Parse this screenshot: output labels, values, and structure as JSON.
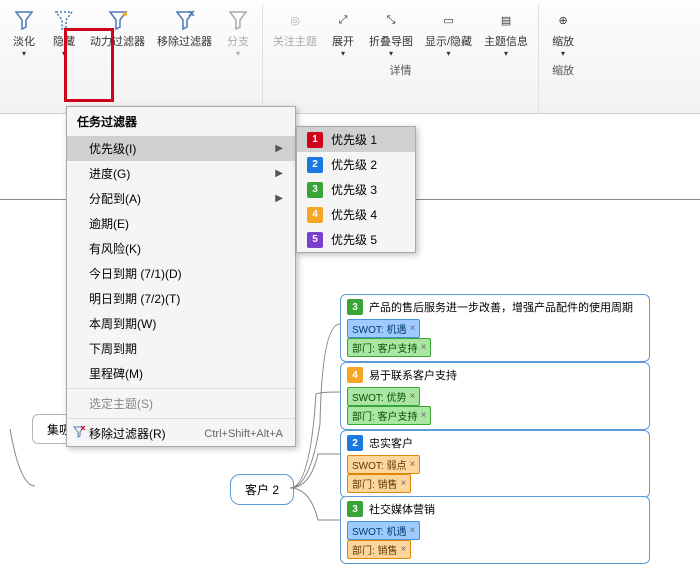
{
  "ribbon": {
    "group_filter_label": "",
    "group_detail_label": "详情",
    "group_zoom_label": "缩放",
    "btn_fade": "淡化",
    "btn_hide": "隐藏",
    "btn_power": "动力过滤器",
    "btn_remove": "移除过滤器",
    "btn_branch": "分支",
    "btn_focus": "关注主题",
    "btn_expand": "展开",
    "btn_collapse": "折叠导图",
    "btn_showhide": "显示/隐藏",
    "btn_topic": "主题信息",
    "btn_zoom": "缩放"
  },
  "menu": {
    "header": "任务过滤器",
    "items": [
      {
        "label": "优先级(I)",
        "arrow": true,
        "hi": true
      },
      {
        "label": "进度(G)",
        "arrow": true
      },
      {
        "label": "分配到(A)",
        "arrow": true
      },
      {
        "label": "逾期(E)"
      },
      {
        "label": "有风险(K)"
      },
      {
        "label": "今日到期 (7/1)(D)"
      },
      {
        "label": "明日到期 (7/2)(T)"
      },
      {
        "label": "本周到期(W)"
      },
      {
        "label": "下周到期"
      },
      {
        "label": "里程碑(M)"
      }
    ],
    "disabled": "选定主题(S)",
    "remove": "移除过滤器(R)",
    "remove_sc": "Ctrl+Shift+Alt+A"
  },
  "submenu": {
    "items": [
      {
        "num": "1",
        "label": "优先级 1",
        "color": "#d0021b",
        "hi": true
      },
      {
        "num": "2",
        "label": "优先级 2",
        "color": "#1b7ae0"
      },
      {
        "num": "3",
        "label": "优先级 3",
        "color": "#3aa537"
      },
      {
        "num": "4",
        "label": "优先级 4",
        "color": "#f5a623"
      },
      {
        "num": "5",
        "label": "优先级 5",
        "color": "#7b3fce"
      }
    ]
  },
  "mindmap": {
    "partial_node": "集吸尘器市场反馈",
    "customer_node": "客户 2",
    "cards": [
      {
        "num": "3",
        "num_color": "#3aa537",
        "title": "产品的售后服务进一步改善，增强产品配件的使用周期",
        "tags": [
          {
            "cls": "t-blue",
            "text": "SWOT: 机遇"
          },
          {
            "cls": "t-green",
            "text": "部门: 客户支持"
          }
        ]
      },
      {
        "num": "4",
        "num_color": "#f5a623",
        "title": "易于联系客户支持",
        "tags": [
          {
            "cls": "t-green",
            "text": "SWOT: 优势"
          },
          {
            "cls": "t-green",
            "text": "部门: 客户支持"
          }
        ]
      },
      {
        "num": "2",
        "num_color": "#1b7ae0",
        "title": "忠实客户",
        "tags": [
          {
            "cls": "t-orange",
            "text": "SWOT: 弱点"
          },
          {
            "cls": "t-orange",
            "text": "部门: 销售"
          }
        ]
      },
      {
        "num": "3",
        "num_color": "#3aa537",
        "title": "社交媒体营销",
        "tags": [
          {
            "cls": "t-blue",
            "text": "SWOT: 机遇"
          },
          {
            "cls": "t-orange",
            "text": "部门: 销售"
          }
        ]
      }
    ]
  }
}
